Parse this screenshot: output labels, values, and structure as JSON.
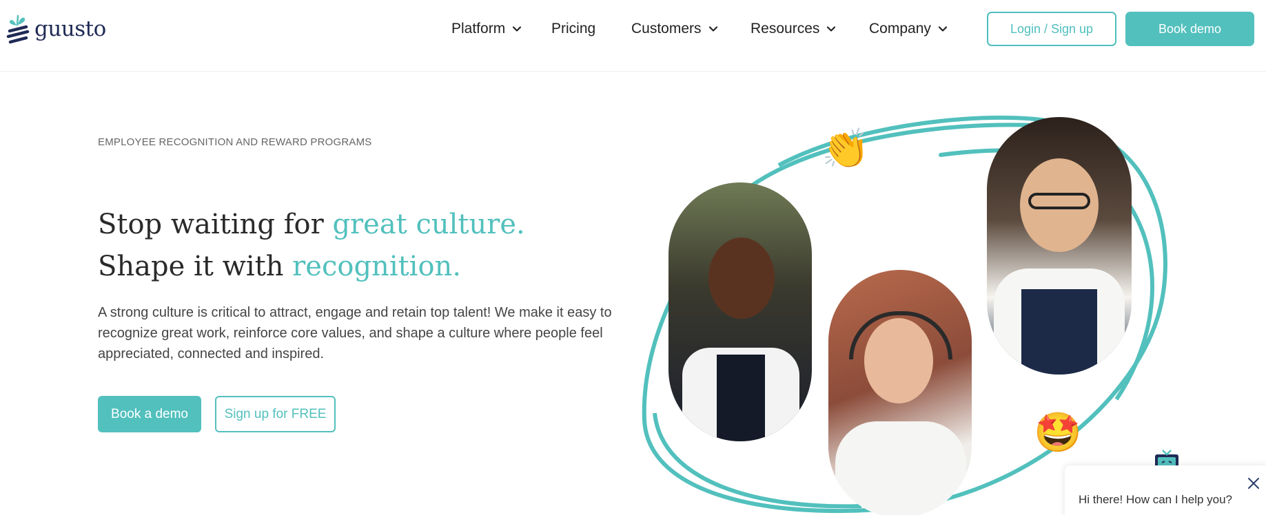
{
  "header": {
    "logo_text": "guusto",
    "nav": [
      {
        "label": "Platform",
        "has_dropdown": true
      },
      {
        "label": "Pricing",
        "has_dropdown": false
      },
      {
        "label": "Customers",
        "has_dropdown": true
      },
      {
        "label": "Resources",
        "has_dropdown": true
      },
      {
        "label": "Company",
        "has_dropdown": true
      }
    ],
    "login_label": "Login / Sign up",
    "demo_label": "Book demo"
  },
  "hero": {
    "eyebrow": "EMPLOYEE RECOGNITION AND REWARD PROGRAMS",
    "headline_line1_plain": "Stop waiting for ",
    "headline_line1_accent": "great culture.",
    "headline_line2_plain": "Shape it with ",
    "headline_line2_accent": "recognition.",
    "lead": "A strong culture is critical to attract, engage and retain top talent! We make it easy to recognize great work, reinforce core values, and shape a culture where people feel appreciated, connected and inspired.",
    "primary_cta": "Book a demo",
    "secondary_cta": "Sign up for FREE"
  },
  "illustration": {
    "emoji_clap": "👏",
    "emoji_star_struck": "🤩"
  },
  "chat": {
    "greeting": "Hi there! How can I help you?"
  },
  "colors": {
    "accent": "#52c0bd",
    "brand_navy": "#1f2a55",
    "text": "#2a2a2a"
  }
}
